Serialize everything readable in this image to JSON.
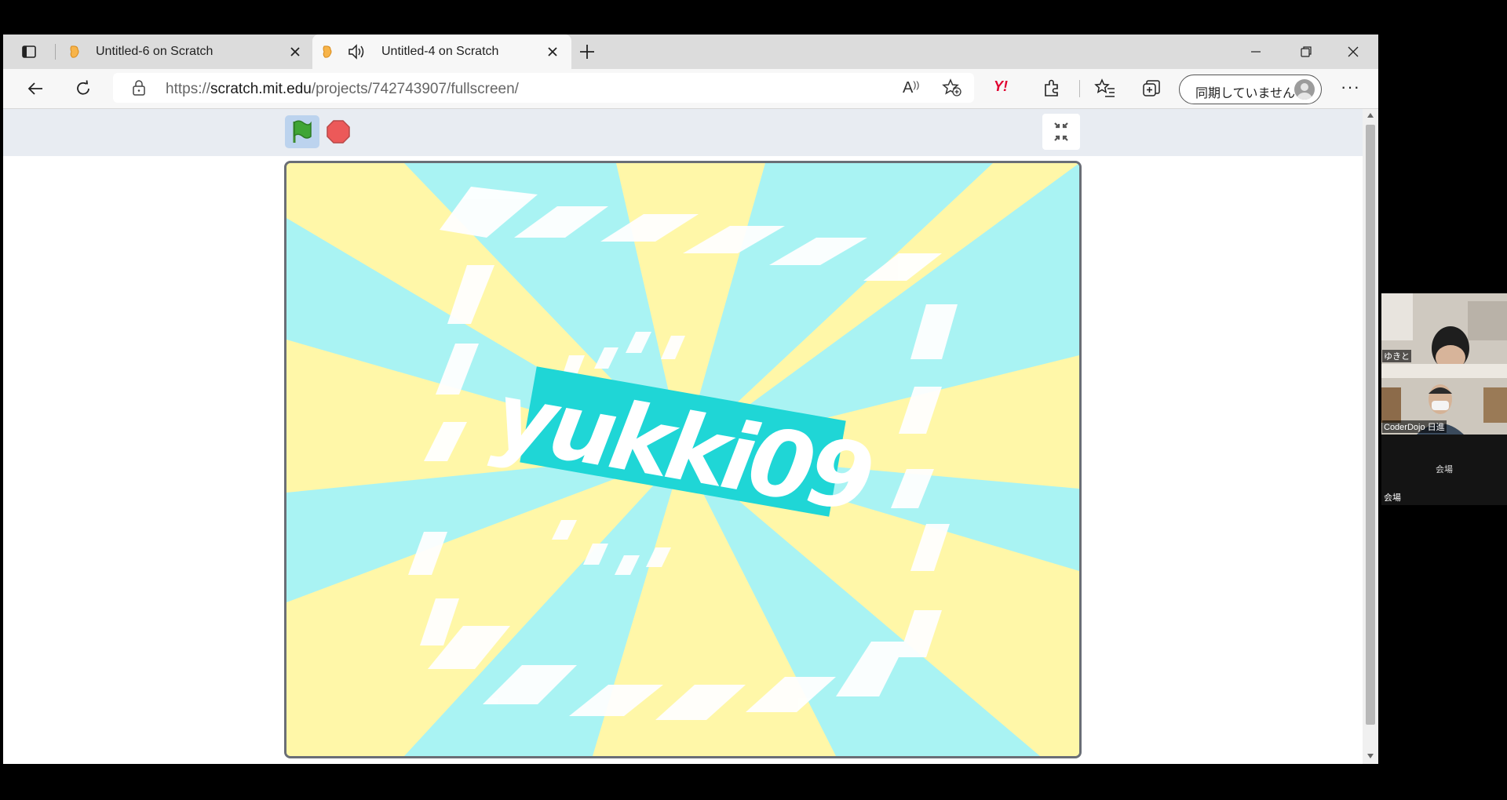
{
  "browser": {
    "tabs": [
      {
        "title": "Untitled-6 on Scratch",
        "active": false
      },
      {
        "title": "Untitled-4 on Scratch",
        "active": true
      }
    ],
    "url_prefix": "https://",
    "url_host": "scratch.mit.edu",
    "url_path": "/projects/742743907/fullscreen/",
    "profile_label": "同期していません"
  },
  "scratch": {
    "stage_title": "yukki09",
    "colors": {
      "yellow": "#fff7a8",
      "cyan": "#a9f3f3",
      "banner": "#1fd6d6"
    }
  },
  "video_panel": {
    "participants": [
      {
        "name": "ゆきと"
      },
      {
        "name": "CoderDojo 日進"
      },
      {
        "name": "会場",
        "center_label": "会場"
      }
    ]
  }
}
